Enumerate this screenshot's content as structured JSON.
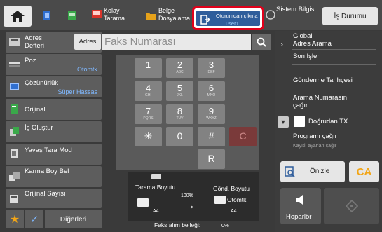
{
  "topbar": {
    "kolay_tarama": [
      "Kolay",
      "Tarama"
    ],
    "belge_dosyalama": [
      "Belge",
      "Dosyalama"
    ],
    "logout_label": "Oturumdan çıkma",
    "logout_user": "user1",
    "system_info": "Sistem Bilgisi.",
    "status": "İş Durumu"
  },
  "left": {
    "address_book": [
      "Adres",
      "Defteri"
    ],
    "poz": "Poz",
    "poz_value": "Otomtk",
    "resolution": "Çözünürlük",
    "resolution_value": "Süper Hassas",
    "original": "Orijinal",
    "job_build": "İş Oluştur",
    "slow_scan": "Yavaş Tara Mod",
    "mixed_size": "Karma Boy Bel",
    "original_count": "Orijinal Sayısı",
    "others": "Diğerleri"
  },
  "address_row": {
    "adres_button": "Adres",
    "fax_placeholder": "Faks Numarası"
  },
  "keypad": [
    {
      "n": "1",
      "s": ""
    },
    {
      "n": "2",
      "s": "ABC"
    },
    {
      "n": "3",
      "s": "DEF"
    },
    {
      "n": "4",
      "s": "GHI"
    },
    {
      "n": "5",
      "s": "JKL"
    },
    {
      "n": "6",
      "s": "MNO"
    },
    {
      "n": "7",
      "s": "PQRS"
    },
    {
      "n": "8",
      "s": "TUV"
    },
    {
      "n": "9",
      "s": "WXYZ"
    },
    {
      "n": "✳",
      "s": ""
    },
    {
      "n": "0",
      "s": ""
    },
    {
      "n": "#",
      "s": ""
    },
    {
      "n": "C",
      "s": ""
    },
    {
      "n": "R",
      "s": ""
    }
  ],
  "bottom": {
    "scan_size": "Tarama Boyutu",
    "send_size": "Gönd. Boyutu",
    "percent": "100%",
    "auto": "Otomtk",
    "a4_left": "A4",
    "a4_right": "A4",
    "fax_memory_label": "Faks alım belleği:",
    "fax_memory_value": "0%"
  },
  "right": {
    "global_search": [
      "Global",
      "Adres Arama"
    ],
    "recent_jobs": "Son İşler",
    "send_history": "Gönderme Tarihçesi",
    "call_search": [
      "Arama Numarasını",
      "çağır"
    ],
    "direct_tx": "Doğrudan TX",
    "program_call": "Programı çağır",
    "program_sub": "Kayıtlı ayarları çağır",
    "preview": "Önizle",
    "ca": "CA",
    "speaker": "Hoparlör"
  },
  "colors": {
    "accent_red": "#e0001a",
    "logout_blue": "#2f5d9b",
    "value_blue": "#7fb8ff",
    "ca_orange": "#f2a516"
  }
}
